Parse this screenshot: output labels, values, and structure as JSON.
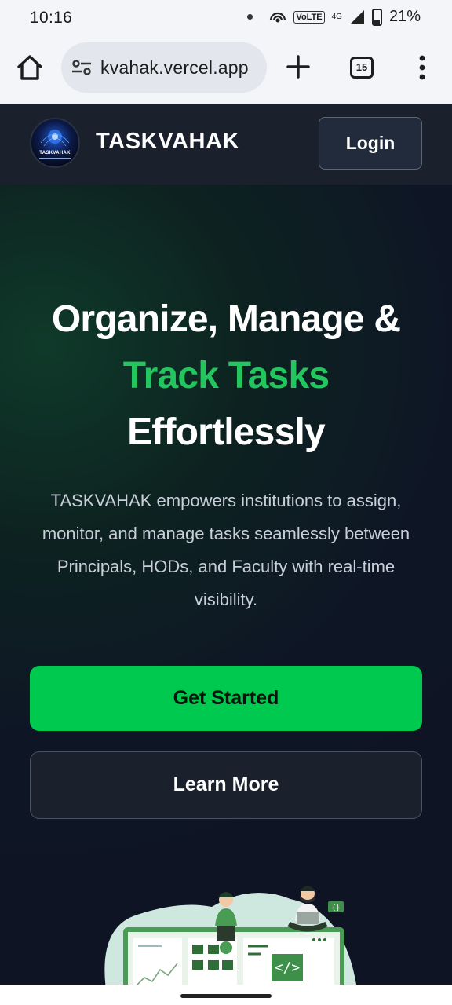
{
  "status_bar": {
    "time": "10:16",
    "network": "VoLTE",
    "network_type": "4G",
    "battery": "21%"
  },
  "browser": {
    "url": "kvahak.vercel.app",
    "tab_count": "15"
  },
  "header": {
    "logo_text": "TASKVAHAK",
    "brand": "TASKVAHAK",
    "login_label": "Login"
  },
  "hero": {
    "headline_line1": "Organize, Manage &",
    "headline_accent": "Track Tasks",
    "headline_line3": "Effortlessly",
    "description": "TASKVAHAK empowers institutions to assign, monitor, and manage tasks seamlessly between Principals, HODs, and Faculty with real-time visibility.",
    "primary_cta": "Get Started",
    "secondary_cta": "Learn More"
  },
  "colors": {
    "accent": "#22c55e",
    "primary_button": "#00c94f",
    "header_bg": "#1a202c"
  }
}
